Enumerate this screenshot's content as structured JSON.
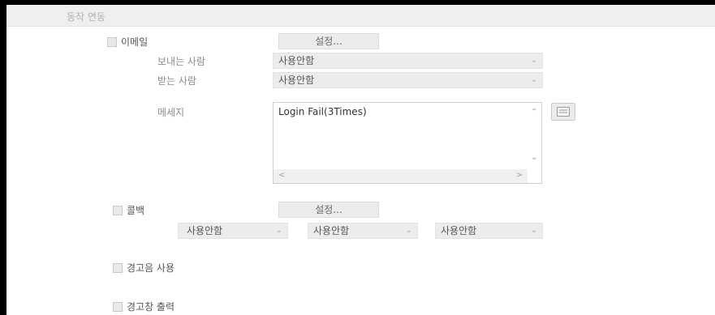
{
  "section": {
    "title": "동작 연동"
  },
  "email": {
    "checkbox_label": "이메일",
    "settings_button": "설정...",
    "sender_label": "보내는 사람",
    "sender_value": "사용안함",
    "receiver_label": "받는 사람",
    "receiver_value": "사용안함",
    "message_label": "메세지",
    "message_text": "Login Fail(3Times)",
    "keyboard_icon": "keyboard-icon"
  },
  "callback": {
    "checkbox_label": "콜백",
    "settings_button": "설정...",
    "selects": [
      "사용안함",
      "사용안함",
      "사용안함"
    ]
  },
  "alarm_sound": {
    "checkbox_label": "경고음 사용"
  },
  "alarm_popup": {
    "checkbox_label": "경고창 출력"
  },
  "icons": {
    "chevron": "chevron-down-icon",
    "scroll_up": "scroll-up-icon",
    "scroll_down": "scroll-down-icon",
    "scroll_left": "scroll-left-icon",
    "scroll_right": "scroll-right-icon"
  }
}
